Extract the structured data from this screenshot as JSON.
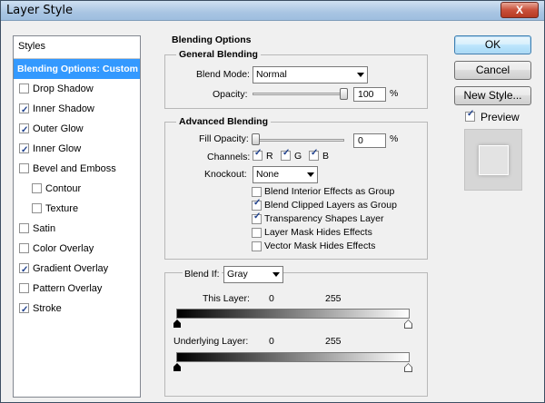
{
  "window": {
    "title": "Layer Style",
    "close_label": "X"
  },
  "styles_panel": {
    "header": "Styles",
    "selected": "Blending Options: Custom",
    "items": [
      {
        "label": "Drop Shadow",
        "checked": false,
        "sub": false
      },
      {
        "label": "Inner Shadow",
        "checked": true,
        "sub": false
      },
      {
        "label": "Outer Glow",
        "checked": true,
        "sub": false
      },
      {
        "label": "Inner Glow",
        "checked": true,
        "sub": false
      },
      {
        "label": "Bevel and Emboss",
        "checked": false,
        "sub": false
      },
      {
        "label": "Contour",
        "checked": false,
        "sub": true
      },
      {
        "label": "Texture",
        "checked": false,
        "sub": true
      },
      {
        "label": "Satin",
        "checked": false,
        "sub": false
      },
      {
        "label": "Color Overlay",
        "checked": false,
        "sub": false
      },
      {
        "label": "Gradient Overlay",
        "checked": true,
        "sub": false
      },
      {
        "label": "Pattern Overlay",
        "checked": false,
        "sub": false
      },
      {
        "label": "Stroke",
        "checked": true,
        "sub": false
      }
    ]
  },
  "blending_options": {
    "title": "Blending Options",
    "general": {
      "title": "General Blending",
      "blend_mode_label": "Blend Mode:",
      "blend_mode_value": "Normal",
      "opacity_label": "Opacity:",
      "opacity_value": "100",
      "opacity_unit": "%",
      "opacity_fraction": 1.0
    },
    "advanced": {
      "title": "Advanced Blending",
      "fill_opacity_label": "Fill Opacity:",
      "fill_opacity_value": "0",
      "fill_opacity_unit": "%",
      "fill_opacity_fraction": 0.0,
      "channels_label": "Channels:",
      "channels": [
        {
          "label": "R",
          "checked": true
        },
        {
          "label": "G",
          "checked": true
        },
        {
          "label": "B",
          "checked": true
        }
      ],
      "knockout_label": "Knockout:",
      "knockout_value": "None",
      "options": [
        {
          "label": "Blend Interior Effects as Group",
          "checked": false
        },
        {
          "label": "Blend Clipped Layers as Group",
          "checked": true
        },
        {
          "label": "Transparency Shapes Layer",
          "checked": true
        },
        {
          "label": "Layer Mask Hides Effects",
          "checked": false
        },
        {
          "label": "Vector Mask Hides Effects",
          "checked": false
        }
      ]
    },
    "blend_if": {
      "label": "Blend If:",
      "value": "Gray",
      "this_layer_label": "This Layer:",
      "this_layer_min": "0",
      "this_layer_max": "255",
      "underlying_label": "Underlying Layer:",
      "underlying_min": "0",
      "underlying_max": "255"
    }
  },
  "buttons": {
    "ok": "OK",
    "cancel": "Cancel",
    "new_style": "New Style...",
    "preview_label": "Preview",
    "preview_checked": true
  },
  "colors": {
    "selection": "#3399ff",
    "checkmark": "#1d3f8c"
  }
}
